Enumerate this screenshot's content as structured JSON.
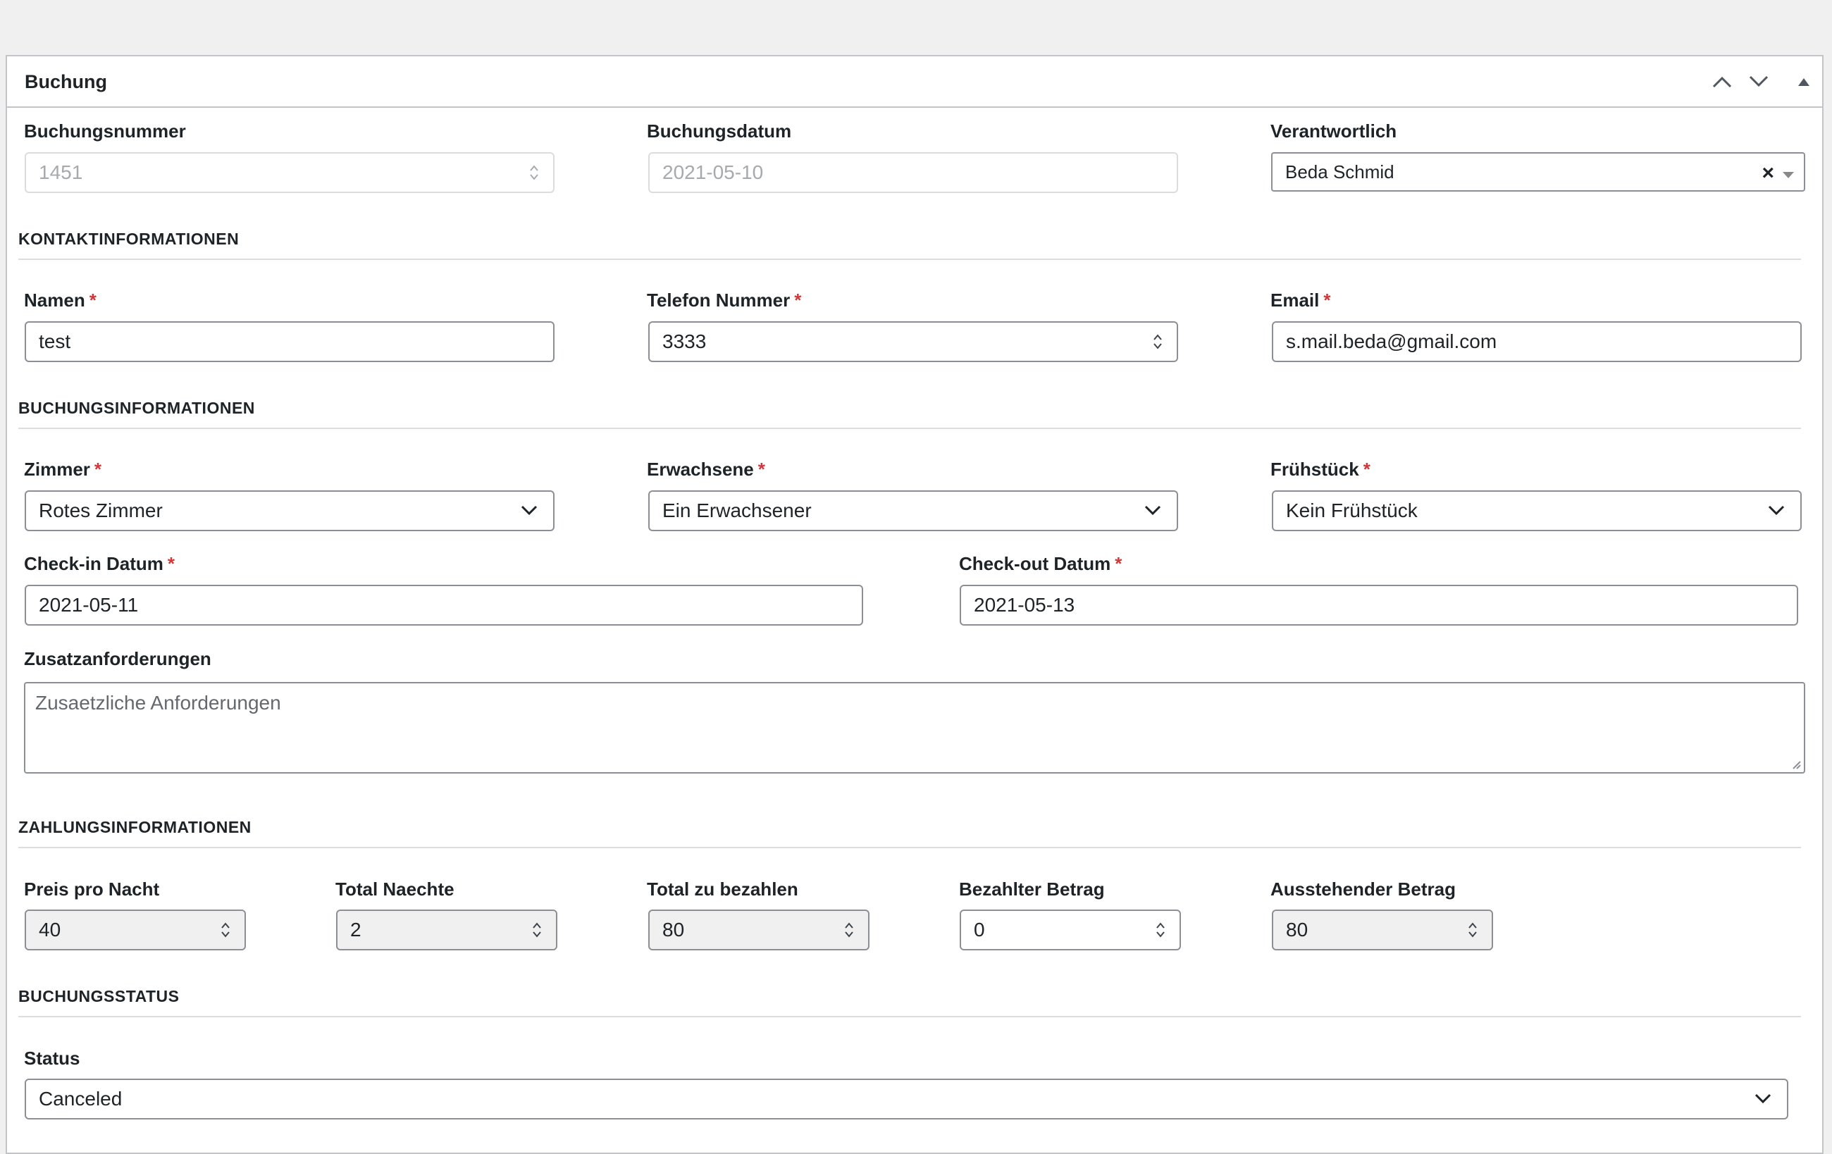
{
  "panel": {
    "title": "Buchung"
  },
  "top_fields": {
    "booking_number_label": "Buchungsnummer",
    "booking_number_value": "1451",
    "booking_date_label": "Buchungsdatum",
    "booking_date_value": "2021-05-10",
    "responsible_label": "Verantwortlich",
    "responsible_value": "Beda Schmid",
    "clear_symbol": "×"
  },
  "contact": {
    "heading": "KONTAKTINFORMATIONEN",
    "name_label": "Namen",
    "name_value": "test",
    "phone_label": "Telefon Nummer",
    "phone_value": "3333",
    "email_label": "Email",
    "email_value": "s.mail.beda@gmail.com"
  },
  "booking": {
    "heading": "BUCHUNGSINFORMATIONEN",
    "room_label": "Zimmer",
    "room_value": "Rotes Zimmer",
    "adults_label": "Erwachsene",
    "adults_value": "Ein Erwachsener",
    "breakfast_label": "Frühstück",
    "breakfast_value": "Kein Frühstück",
    "checkin_label": "Check-in Datum",
    "checkin_value": "2021-05-11",
    "checkout_label": "Check-out Datum",
    "checkout_value": "2021-05-13",
    "extras_label": "Zusatzanforderungen",
    "extras_placeholder": "Zusaetzliche Anforderungen"
  },
  "payment": {
    "heading": "ZAHLUNGSINFORMATIONEN",
    "price_label": "Preis pro Nacht",
    "price_value": "40",
    "nights_label": "Total Naechte",
    "nights_value": "2",
    "total_label": "Total zu bezahlen",
    "total_value": "80",
    "paid_label": "Bezahlter Betrag",
    "paid_value": "0",
    "outstanding_label": "Ausstehender Betrag",
    "outstanding_value": "80"
  },
  "status": {
    "heading": "BUCHUNGSSTATUS",
    "status_label": "Status",
    "status_value": "Canceled"
  },
  "required_marker": "*",
  "icons": {
    "move_up": "chevron-up-icon",
    "move_down": "chevron-down-icon",
    "toggle": "triangle-up-icon"
  },
  "colors": {
    "required": "#d63638",
    "border": "#8c8f94",
    "readonly_bg": "#f0f0f1"
  }
}
